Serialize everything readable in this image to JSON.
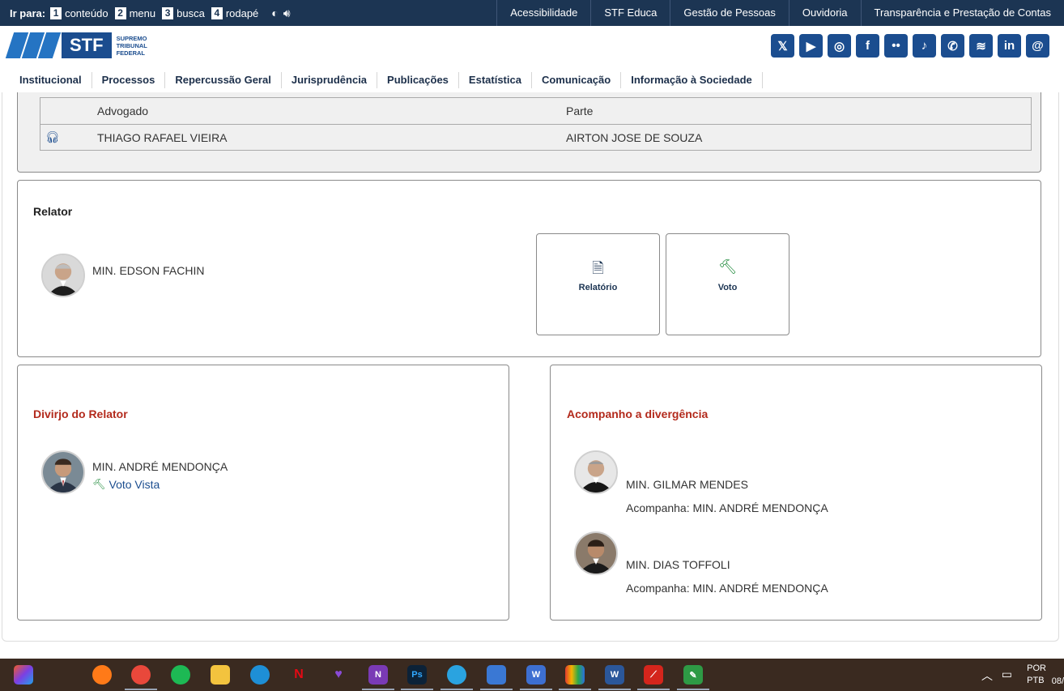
{
  "topbar": {
    "skip_label": "Ir para:",
    "skip_items": [
      {
        "num": "1",
        "label": "conteúdo"
      },
      {
        "num": "2",
        "label": "menu"
      },
      {
        "num": "3",
        "label": "busca"
      },
      {
        "num": "4",
        "label": "rodapé"
      }
    ],
    "links": [
      "Acessibilidade",
      "STF Educa",
      "Gestão de Pessoas",
      "Ouvidoria",
      "Transparência e Prestação de Contas"
    ]
  },
  "brand": {
    "logo_text": "STF",
    "logo_sub": [
      "SUPREMO",
      "TRIBUNAL",
      "FEDERAL"
    ],
    "social_icons": [
      "x-icon",
      "youtube-icon",
      "instagram-icon",
      "facebook-icon",
      "flickr-icon",
      "tiktok-icon",
      "whatsapp-icon",
      "spotify-icon",
      "linkedin-icon",
      "threads-icon"
    ],
    "social_glyphs": [
      "𝕏",
      "▶",
      "◎",
      "f",
      "••",
      "♪",
      "✆",
      "≋",
      "in",
      "@"
    ]
  },
  "nav": [
    "Institucional",
    "Processos",
    "Repercussão Geral",
    "Jurisprudência",
    "Publicações",
    "Estatística",
    "Comunicação",
    "Informação à Sociedade"
  ],
  "advogados": {
    "headers": {
      "advogado": "Advogado",
      "parte": "Parte"
    },
    "rows": [
      {
        "advogado": "THIAGO RAFAEL VIEIRA",
        "parte": "AIRTON JOSE DE SOUZA"
      }
    ]
  },
  "relator": {
    "title": "Relator",
    "name": "MIN. EDSON FACHIN",
    "buttons": [
      {
        "label": "Relatório",
        "icon": "document-icon"
      },
      {
        "label": "Voto",
        "icon": "gavel-icon"
      }
    ]
  },
  "divirjo": {
    "title": "Divirjo do Relator",
    "name": "MIN. ANDRÉ MENDONÇA",
    "link": "Voto Vista"
  },
  "acompanho": {
    "title": "Acompanho a divergência",
    "ministros": [
      {
        "name": "MIN. GILMAR MENDES",
        "sub": "Acompanha: MIN. ANDRÉ MENDONÇA"
      },
      {
        "name": "MIN. DIAS TOFFOLI",
        "sub": "Acompanha: MIN. ANDRÉ MENDONÇA"
      }
    ]
  },
  "taskbar": {
    "lang_top": "POR",
    "lang_bottom": "PTB",
    "time_fragment": "08/"
  },
  "colors": {
    "topbar": "#1c3553",
    "brand_blue": "#1b4d8f",
    "red_heading": "#b32a1c",
    "gavel_green": "#1f8a3b"
  }
}
